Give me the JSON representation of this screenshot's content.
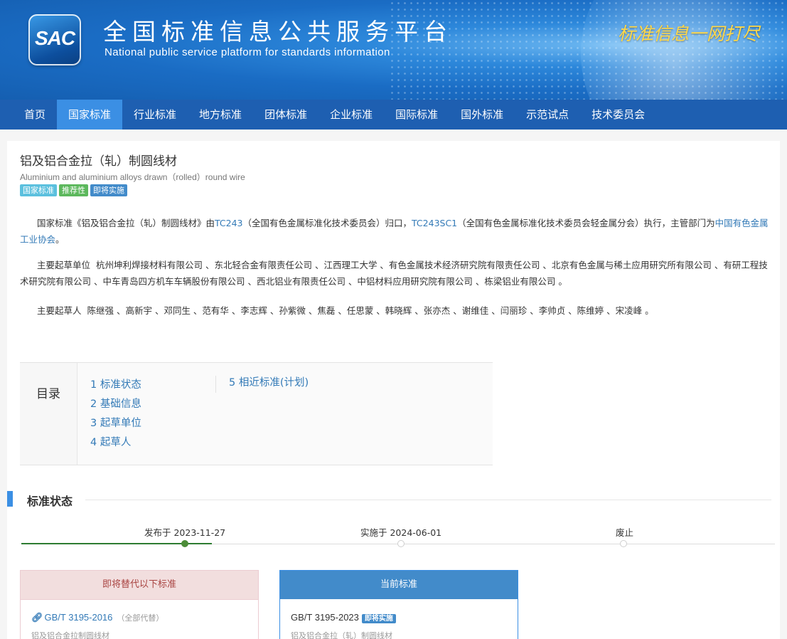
{
  "banner": {
    "logo_text": "SAC",
    "title_cn": "全国标准信息公共服务平台",
    "title_en": "National public service platform  for standards information",
    "slogan": "标准信息一网打尽"
  },
  "nav": {
    "items": [
      "首页",
      "国家标准",
      "行业标准",
      "地方标准",
      "团体标准",
      "企业标准",
      "国际标准",
      "国外标准",
      "示范试点",
      "技术委员会"
    ],
    "active_index": 1
  },
  "standard": {
    "title": "铝及铝合金拉（轧）制圆线材",
    "title_en": "Aluminium and aluminium alloys drawn（rolled）round wire",
    "tags": [
      "国家标准",
      "推荐性",
      "即将实施"
    ]
  },
  "intro": {
    "p1_prefix": "国家标准《铝及铝合金拉（轧）制圆线材》由",
    "p1_tc1": "TC243",
    "p1_mid1": "（全国有色金属标准化技术委员会）归口，",
    "p1_tc2": "TC243SC1",
    "p1_mid2": "（全国有色金属标准化技术委员会轻金属分会）执行，主管部门为",
    "p1_dept": "中国有色金属工业协会",
    "p1_end": "。",
    "p2_label": "主要起草单位",
    "p2_orgs": "杭州坤利焊接材料有限公司 、东北轻合金有限责任公司 、江西理工大学 、有色金属技术经济研究院有限责任公司 、北京有色金属与稀土应用研究所有限公司 、有研工程技术研究院有限公司 、中车青岛四方机车车辆股份有限公司 、西北铝业有限责任公司 、中铝材料应用研究院有限公司 、栋梁铝业有限公司 。",
    "p3_label": "主要起草人",
    "p3_people": "陈继强 、高新宇 、邓同生 、范有华 、李志辉 、孙紫微 、焦磊 、任思蒙 、韩晓辉 、张亦杰 、谢维佳 、闫丽珍 、李帅贞 、陈维婷 、宋凌峰 。"
  },
  "toc": {
    "label": "目录",
    "items": [
      "1 标准状态",
      "2 基础信息",
      "3 起草单位",
      "4 起草人",
      "5 相近标准(计划)"
    ]
  },
  "status_section": {
    "title": "标准状态",
    "published": "发布于 2023-11-27",
    "implemented": "实施于 2024-06-01",
    "abolished": "废止"
  },
  "cards": {
    "replace_header": "即将替代以下标准",
    "replace_code": "GB/T 3195-2016",
    "replace_note": "（全部代替）",
    "replace_name": "铝及铝合金拉制圆线材",
    "current_header": "当前标准",
    "current_code": "GB/T 3195-2023",
    "current_badge": "即将实施",
    "current_name": "铝及铝合金拉（轧）制圆线材"
  }
}
